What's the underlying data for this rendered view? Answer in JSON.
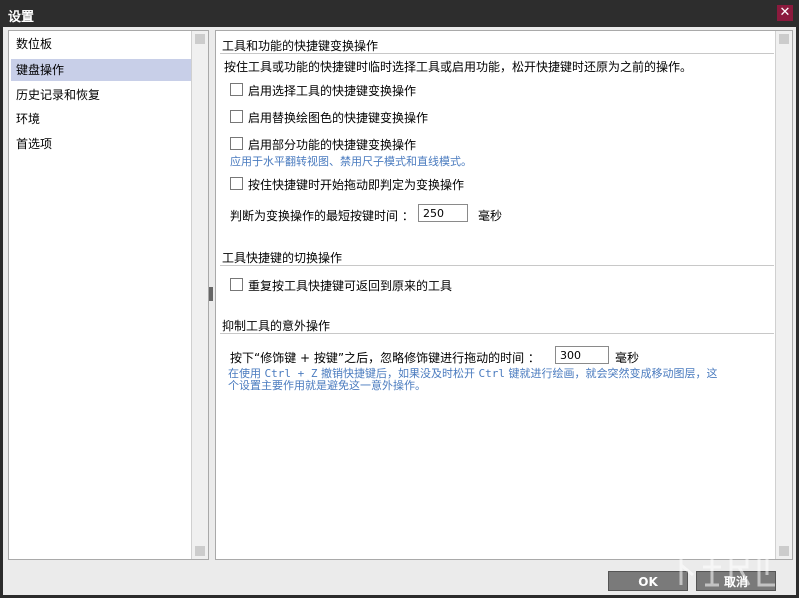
{
  "window": {
    "title": "设置",
    "close_glyph": "✕"
  },
  "sidebar": {
    "items": [
      {
        "label": "数位板",
        "selected": false
      },
      {
        "label": "键盘操作",
        "selected": true
      },
      {
        "label": "历史记录和恢复",
        "selected": false
      },
      {
        "label": "环境",
        "selected": false
      },
      {
        "label": "首选项",
        "selected": false
      }
    ]
  },
  "section1": {
    "header": "工具和功能的快捷键变换操作",
    "description": "按住工具或功能的快捷键时临时选择工具或启用功能，松开快捷键时还原为之前的操作。",
    "options": [
      {
        "label": "启用选择工具的快捷键变换操作",
        "checked": false
      },
      {
        "label": "启用替换绘图色的快捷键变换操作",
        "checked": false
      },
      {
        "label": "启用部分功能的快捷键变换操作",
        "checked": false,
        "hint": "应用于水平翻转视图、禁用尺子模式和直线模式。"
      },
      {
        "label": "按住快捷键时开始拖动即判定为变换操作",
        "checked": false
      }
    ],
    "min_time": {
      "label": "判断为变换操作的最短按键时间 ：",
      "value": "250",
      "unit": "毫秒"
    }
  },
  "section2": {
    "header": "工具快捷键的切换操作",
    "option": {
      "label": "重复按工具快捷键可返回到原来的工具",
      "checked": false
    }
  },
  "section3": {
    "header": "抑制工具的意外操作",
    "ignore_time": {
      "label": "按下“修饰键 + 按键”之后，忽略修饰键进行拖动的时间 ：",
      "value": "300",
      "unit": "毫秒"
    },
    "hint_line1_a": "在使用 ",
    "hint_line1_code1": "Ctrl + Z",
    "hint_line1_b": " 撤销快捷键后，如果没及时松开 ",
    "hint_line1_code2": "Ctrl",
    "hint_line1_c": " 键就进行绘画，就会突然变成移动图层，这",
    "hint_line2": "个设置主要作用就是避免这一意外操作。"
  },
  "buttons": {
    "ok": "OK",
    "cancel": "取消"
  },
  "colors": {
    "title_bar": "#2d2d2d",
    "close_button": "#8b1a3d",
    "selected_item": "#c8cfe8",
    "hint_text": "#4a7bbf"
  }
}
